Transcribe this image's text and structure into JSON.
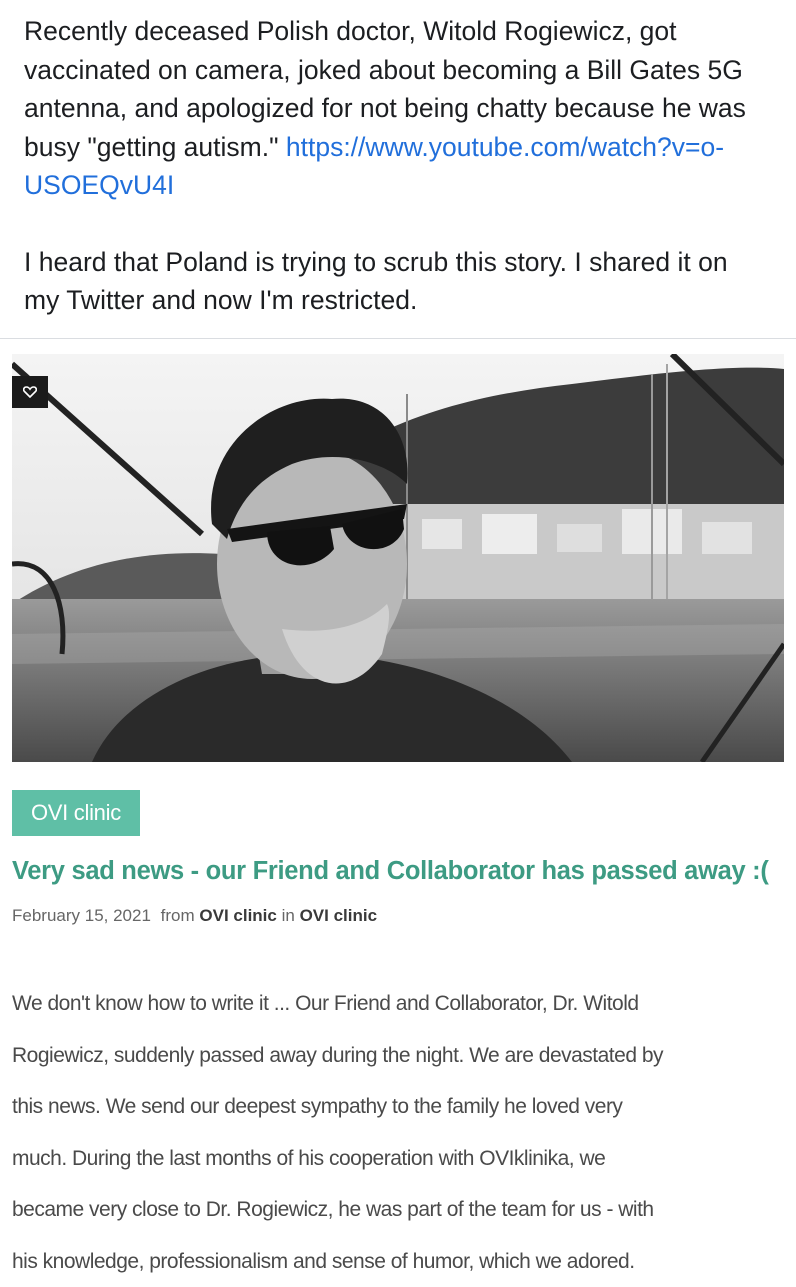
{
  "post": {
    "paragraph1": "Recently deceased Polish doctor, Witold Rogiewicz, got vaccinated on camera, joked about becoming a Bill Gates 5G antenna, and apologized for not being chatty because he was busy \"getting autism.\"",
    "link_text": "https://www.youtube.com/watch?v=o-USOEQvU4I",
    "paragraph2": "I heard that Poland is trying to scrub this story. I shared it on my Twitter and now I'm restricted."
  },
  "photo": {
    "badge_icon": "heart-icon"
  },
  "article": {
    "tag": "OVI clinic",
    "title": "Very sad news - our Friend and Collaborator has passed away :(",
    "date": "February 15, 2021",
    "from_label": "from",
    "author": "OVI clinic",
    "in_label": "in",
    "category": "OVI clinic",
    "body_lines": [
      "We don't know how to write it ... Our Friend and Collaborator, Dr. Witold",
      "Rogiewicz, suddenly passed away during the night. We are devastated by",
      "this news. We send our deepest sympathy to the family he loved very",
      "much. During the last months of his cooperation with OVIklinika, we",
      "became very close to Dr. Rogiewicz, he was part of the team for us - with",
      "his knowledge, professionalism and sense of humor, which we adored."
    ]
  },
  "colors": {
    "link": "#216fdb",
    "tag_bg": "#5fbfa6",
    "title": "#3d9b83"
  }
}
